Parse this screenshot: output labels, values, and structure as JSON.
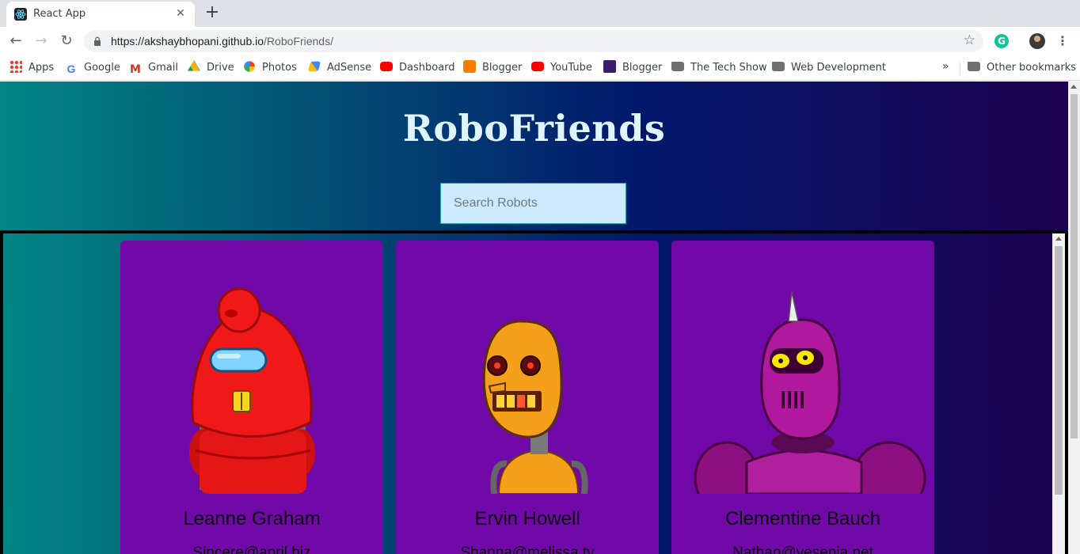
{
  "browser": {
    "tab_title": "React App",
    "tab_close": "✕",
    "new_tab": "+",
    "url_domain": "https://akshaybhopani.github.io",
    "url_path": "/RoboFriends/",
    "bookmarks": [
      {
        "label": "Apps",
        "icon": "apps-icon"
      },
      {
        "label": "Google",
        "icon": "google-icon"
      },
      {
        "label": "Gmail",
        "icon": "gmail-icon"
      },
      {
        "label": "Drive",
        "icon": "drive-icon"
      },
      {
        "label": "Photos",
        "icon": "photos-icon"
      },
      {
        "label": "AdSense",
        "icon": "adsense-icon"
      },
      {
        "label": "Dashboard",
        "icon": "youtube-icon"
      },
      {
        "label": "Blogger",
        "icon": "blogger-icon"
      },
      {
        "label": "YouTube",
        "icon": "youtube-icon"
      },
      {
        "label": "Blogger",
        "icon": "blogger-icon"
      },
      {
        "label": "The Tech Show",
        "icon": "folder-icon"
      },
      {
        "label": "Web Development",
        "icon": "folder-icon"
      }
    ],
    "more_bookmarks": "»",
    "other_bookmarks": "Other bookmarks"
  },
  "app": {
    "title": "RoboFriends",
    "search_placeholder": "Search Robots",
    "colors": {
      "gradient_start": "#028685",
      "gradient_end": "#1e0150",
      "card": "#7109a9",
      "search_bg": "#cdeafd"
    },
    "robots": [
      {
        "name": "Leanne Graham",
        "email": "Sincere@april.biz",
        "color": "red"
      },
      {
        "name": "Ervin Howell",
        "email": "Shanna@melissa.tv",
        "color": "orange"
      },
      {
        "name": "Clementine Bauch",
        "email": "Nathan@yesenia.net",
        "color": "magenta"
      }
    ]
  }
}
